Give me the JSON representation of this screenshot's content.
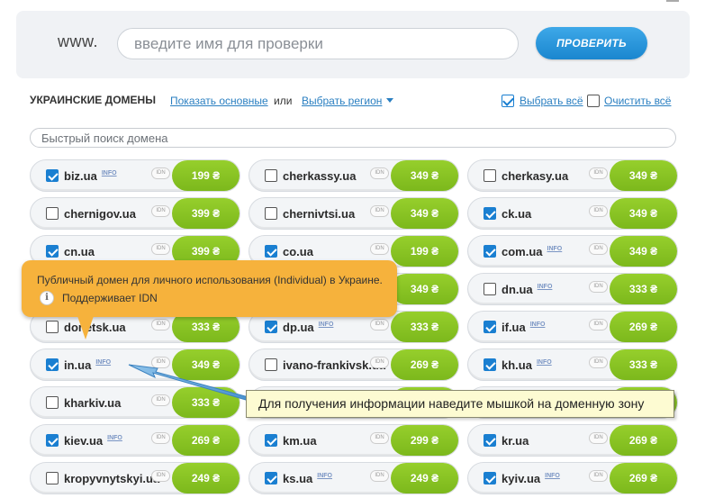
{
  "search": {
    "prefix": "www.",
    "placeholder": "введите имя для проверки",
    "button_label": "ПРОВЕРИТЬ"
  },
  "header": {
    "title": "УКРАИНСКИЕ ДОМЕНЫ",
    "show_main": "Показать основные",
    "or": "или",
    "choose_region": "Выбрать регион",
    "select_all": "Выбрать всё",
    "clear_all": "Очистить всё"
  },
  "quick_search": {
    "placeholder": "Быстрый поиск домена"
  },
  "domains": [
    {
      "name": "biz.ua",
      "checked": true,
      "info": true,
      "idn": true,
      "price": "199 ₴"
    },
    {
      "name": "cherkassy.ua",
      "checked": false,
      "info": false,
      "idn": true,
      "price": "349 ₴"
    },
    {
      "name": "cherkasy.ua",
      "checked": false,
      "info": false,
      "idn": true,
      "price": "349 ₴"
    },
    {
      "name": "chernigov.ua",
      "checked": false,
      "info": false,
      "idn": true,
      "price": "399 ₴"
    },
    {
      "name": "chernivtsi.ua",
      "checked": false,
      "info": false,
      "idn": true,
      "price": "349 ₴"
    },
    {
      "name": "ck.ua",
      "checked": true,
      "info": false,
      "idn": true,
      "price": "349 ₴"
    },
    {
      "name": "cn.ua",
      "checked": true,
      "info": false,
      "idn": true,
      "price": "399 ₴"
    },
    {
      "name": "co.ua",
      "checked": true,
      "info": false,
      "idn": true,
      "price": "199 ₴"
    },
    {
      "name": "com.ua",
      "checked": true,
      "info": true,
      "idn": true,
      "price": "349 ₴"
    },
    {
      "name": "",
      "checked": false,
      "info": false,
      "idn": false,
      "price": ""
    },
    {
      "name": "",
      "checked": false,
      "info": false,
      "idn": false,
      "price": "349 ₴"
    },
    {
      "name": "dn.ua",
      "checked": false,
      "info": true,
      "idn": true,
      "price": "333 ₴"
    },
    {
      "name": "donetsk.ua",
      "checked": false,
      "info": false,
      "idn": true,
      "price": "333 ₴"
    },
    {
      "name": "dp.ua",
      "checked": true,
      "info": true,
      "idn": true,
      "price": "333 ₴"
    },
    {
      "name": "if.ua",
      "checked": true,
      "info": true,
      "idn": true,
      "price": "269 ₴"
    },
    {
      "name": "in.ua",
      "checked": true,
      "info": true,
      "idn": true,
      "price": "349 ₴"
    },
    {
      "name": "ivano-frankivsk.ua",
      "checked": false,
      "info": false,
      "idn": true,
      "price": "269 ₴"
    },
    {
      "name": "kh.ua",
      "checked": true,
      "info": true,
      "idn": true,
      "price": "333 ₴"
    },
    {
      "name": "kharkiv.ua",
      "checked": false,
      "info": false,
      "idn": true,
      "price": "333 ₴"
    },
    {
      "name": "",
      "checked": false,
      "info": false,
      "idn": false,
      "price": ""
    },
    {
      "name": "",
      "checked": false,
      "info": false,
      "idn": false,
      "price": ""
    },
    {
      "name": "kiev.ua",
      "checked": true,
      "info": true,
      "idn": true,
      "price": "269 ₴"
    },
    {
      "name": "km.ua",
      "checked": true,
      "info": false,
      "idn": true,
      "price": "299 ₴"
    },
    {
      "name": "kr.ua",
      "checked": true,
      "info": false,
      "idn": true,
      "price": "269 ₴"
    },
    {
      "name": "kropyvnytskyi.ua",
      "checked": false,
      "info": false,
      "idn": true,
      "price": "249 ₴"
    },
    {
      "name": "ks.ua",
      "checked": true,
      "info": true,
      "idn": true,
      "price": "249 ₴"
    },
    {
      "name": "kyiv.ua",
      "checked": true,
      "info": true,
      "idn": true,
      "price": "269 ₴"
    }
  ],
  "labels": {
    "info": "INFO",
    "idn": "IDN"
  },
  "tooltip": {
    "line1": "Публичный домен для личного использования (Individual) в Украине.",
    "line2": "Поддерживает IDN",
    "icon": "i"
  },
  "hint": {
    "text": "Для получения информации наведите мышкой на доменную зону"
  },
  "colors": {
    "accent_blue": "#1a86cf",
    "price_green": "#8cc425",
    "tooltip_orange": "#f6b23c",
    "hint_bg": "#fdfbd2"
  }
}
